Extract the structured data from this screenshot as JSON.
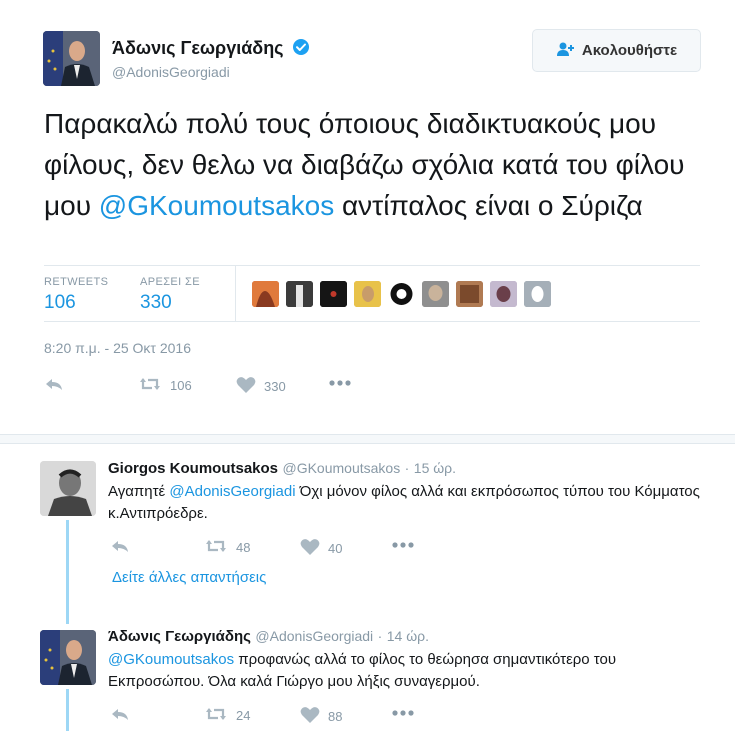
{
  "tweet": {
    "author_name": "Άδωνις Γεωργιάδης",
    "author_handle": "@AdonisGeorgiadi",
    "follow_label": "Ακολουθήστε",
    "text_before": "Παρακαλώ πολύ τους όποιους διαδικτυακούς μου φίλους, δεν θελω να διαβάζω σχόλια κατά του φίλου μου ",
    "text_mention": "@GKoumoutsakos",
    "text_after": " αντίπαλος είναι ο Σύριζα",
    "retweets_label": "RETWEETS",
    "retweets_value": "106",
    "likes_label": "ΑΡΕΣΕΙ ΣΕ",
    "likes_value": "330",
    "timestamp": "8:20 π.μ. - 25 Οκτ 2016",
    "retweet_count": "106",
    "like_count": "330"
  },
  "replies": [
    {
      "author_name": "Giorgos Koumoutsakos",
      "author_handle": "@GKoumoutsakos",
      "dot": "·",
      "time": "15 ώρ.",
      "text_before": "Αγαπητέ ",
      "text_mention": "@AdonisGeorgiadi",
      "text_after": " Όχι μόνον φίλος αλλά και εκπρόσωπος τύπου του Κόμματος κ.Αντιπρόεδρε.",
      "retweet_count": "48",
      "like_count": "40"
    },
    {
      "author_name": "Άδωνις Γεωργιάδης",
      "author_handle": "@AdonisGeorgiadi",
      "dot": "·",
      "time": "14 ώρ.",
      "text_before": "",
      "text_mention": "@GKoumoutsakos",
      "text_after": " προφανώς αλλά το φίλος το θεώρησα σημαντικότερο του Εκπροσώπου. Όλα καλά Γιώργο μου λήξις συναγερμού.",
      "retweet_count": "24",
      "like_count": "88"
    }
  ],
  "more_replies_label": "Δείτε άλλες απαντήσεις",
  "colors": {
    "accent": "#1b95e0",
    "muted": "#8899a6",
    "thread": "#9dd7f5"
  }
}
